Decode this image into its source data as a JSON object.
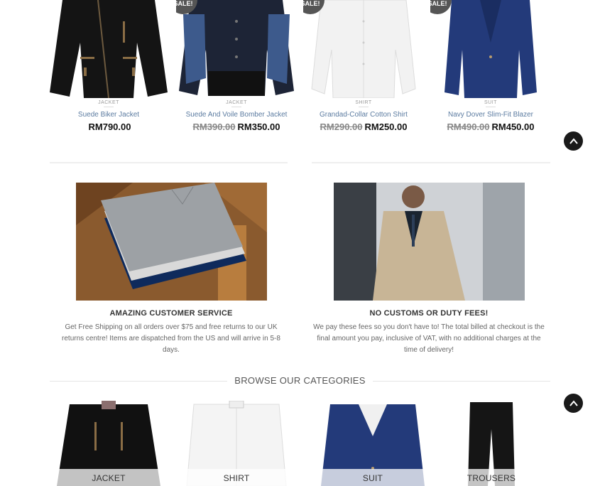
{
  "products": [
    {
      "category": "JACKET",
      "name": "Suede Biker Jacket",
      "old_price": "",
      "price": "RM790.00",
      "sale": ""
    },
    {
      "category": "JACKET",
      "name": "Suede And Voile Bomber Jacket",
      "old_price": "RM390.00",
      "price": "RM350.00",
      "sale": "SALE!"
    },
    {
      "category": "SHIRT",
      "name": "Grandad-Collar Cotton Shirt",
      "old_price": "RM290.00",
      "price": "RM250.00",
      "sale": "SALE!"
    },
    {
      "category": "SUIT",
      "name": "Navy Dover Slim-Fit Blazer",
      "old_price": "RM490.00",
      "price": "RM450.00",
      "sale": "SALE!"
    }
  ],
  "features": [
    {
      "title": "AMAZING CUSTOMER SERVICE",
      "text": "Get Free Shipping on all orders over $75 and free returns to our UK returns centre! Items are dispatched from the US and will arrive in 5-8 days."
    },
    {
      "title": "NO CUSTOMS OR DUTY FEES!",
      "text": "We pay these fees so you don't have to! The total billed at checkout is the final amount you pay, inclusive of VAT, with no additional charges at the time of delivery!"
    }
  ],
  "browse": {
    "title": "BROWSE OUR CATEGORIES"
  },
  "categories": [
    {
      "label": "JACKET"
    },
    {
      "label": "SHIRT"
    },
    {
      "label": "SUIT"
    },
    {
      "label": "TROUSERS"
    }
  ],
  "icons": {
    "back_to_top": "chevron-up-icon"
  },
  "colors": {
    "accent_link": "#5b7ba0",
    "badge": "#555555",
    "dark": "#1a1a1a"
  }
}
